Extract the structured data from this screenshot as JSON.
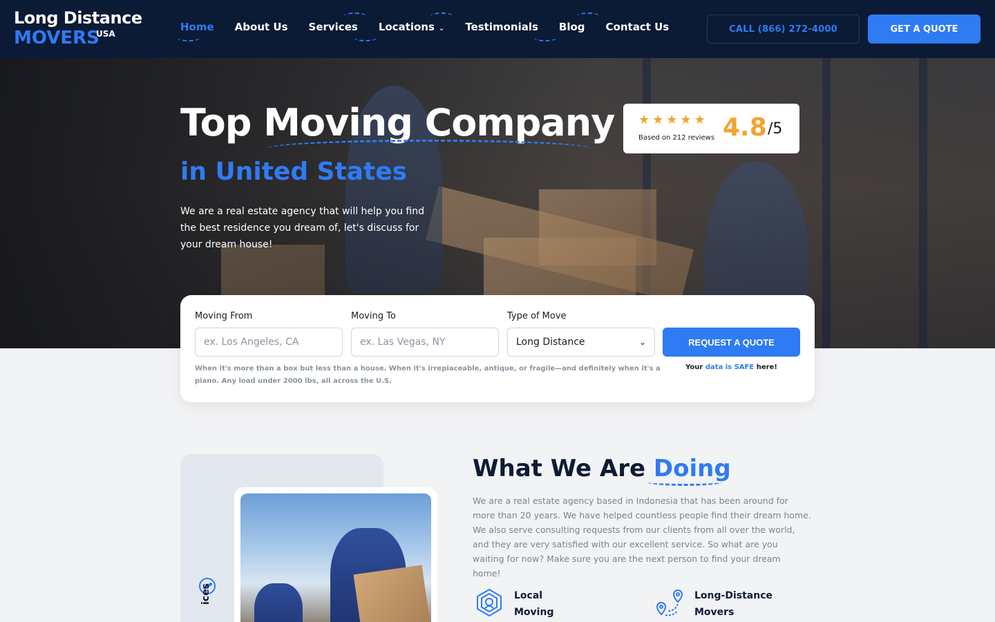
{
  "brand": {
    "line1": "Long Distance",
    "line2": "MOVERS",
    "tag": "USA"
  },
  "nav": {
    "links": [
      {
        "label": "Home",
        "active": true
      },
      {
        "label": "About Us"
      },
      {
        "label": "Services"
      },
      {
        "label": "Locations"
      },
      {
        "label": "Testimonials"
      },
      {
        "label": "Blog"
      },
      {
        "label": "Contact Us"
      }
    ],
    "call_label": "CALL (866) 272-4000",
    "quote_label": "GET A QUOTE"
  },
  "hero": {
    "title": "Top Moving Company",
    "subtitle": "in United States",
    "description": "We are a real estate agency that will help you find the best residence you dream of, let's discuss for your dream house!"
  },
  "rating": {
    "stars": 5,
    "score": "4.8",
    "max": "/5",
    "note": "Based on 212 reviews",
    "star_color": "#f2a330"
  },
  "quote_form": {
    "from_label": "Moving From",
    "from_placeholder": "ex. Los Angeles, CA",
    "to_label": "Moving To",
    "to_placeholder": "ex. Las Vegas, NY",
    "type_label": "Type of Move",
    "type_value": "Long Distance",
    "submit_label": "REQUEST A QUOTE",
    "note": "When it's more than a box but less than a house. When it's irreplaceable, antique, or fragile—and definitely when it's a piano. Any load under 2000 lbs, all across the U.S.",
    "safe_prefix": "Your ",
    "safe_highlight": "data is SAFE",
    "safe_suffix": " here!"
  },
  "about": {
    "title_prefix": "What We Are ",
    "title_highlight": "Doing",
    "description": "We are a real estate agency based in Indonesia that has been around for more than 20 years. We have helped countless people find their dream home. We also serve consulting requests from our clients from all over the world, and they are very satisfied with our excellent service. So what are you waiting for now? Make sure you are the next person to find your dream home!",
    "vertical_label": "ices",
    "features": [
      {
        "title": "Local",
        "subtitle": "Moving",
        "icon": "home-shield-icon"
      },
      {
        "title": "Long-Distance",
        "subtitle": "Movers",
        "icon": "route-pin-icon"
      }
    ]
  },
  "colors": {
    "accent": "#2f7bf3",
    "nav_bg": "#0b1a35",
    "page_bg": "#f2f3f5"
  }
}
